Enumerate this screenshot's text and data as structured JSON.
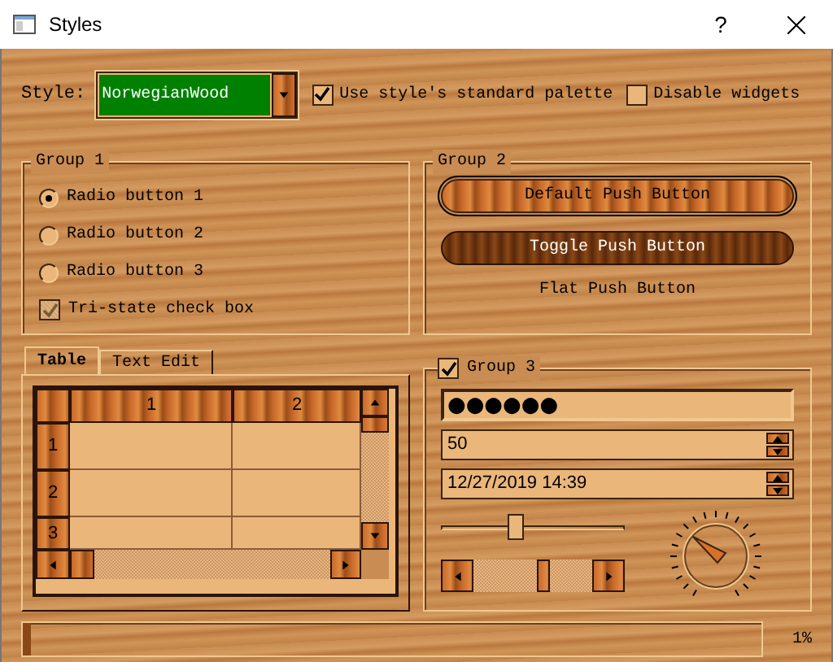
{
  "window": {
    "title": "Styles",
    "help": "?"
  },
  "style_row": {
    "label": "Style:",
    "combo_value": "NorwegianWood"
  },
  "options": [
    {
      "label": "Use style's standard palette",
      "checked": true
    },
    {
      "label": "Disable widgets",
      "checked": false
    }
  ],
  "group_1": {
    "title": "Group 1",
    "radios": [
      {
        "label": "Radio button 1",
        "selected": true
      },
      {
        "label": "Radio button 2",
        "selected": false
      },
      {
        "label": "Radio button 3",
        "selected": false
      }
    ],
    "tristate": {
      "label": "Tri-state check box",
      "partial": true
    }
  },
  "group_2": {
    "title": "Group 2",
    "buttons": [
      {
        "label": "Default Push Button",
        "kind": "default",
        "checked": false
      },
      {
        "label": "Toggle Push Button",
        "kind": "toggle",
        "checked": true
      },
      {
        "label": "Flat Push Button",
        "kind": "flat",
        "checked": false
      }
    ]
  },
  "tabs": [
    {
      "label": "Table",
      "selected": true
    },
    {
      "label": "Text Edit",
      "selected": false
    }
  ],
  "table": {
    "columns": [
      "1",
      "2"
    ],
    "rows": [
      "1",
      "2",
      "3"
    ]
  },
  "group_3": {
    "title": "Group 3",
    "checked": true,
    "password": "●●●●●●",
    "spin_value": "50",
    "datetime": "12/27/2019 14:39",
    "slider": {
      "level": 0.4
    },
    "scrollbar": {
      "level": 0.6
    }
  },
  "progress": {
    "level": 0.01,
    "text": "1%"
  }
}
